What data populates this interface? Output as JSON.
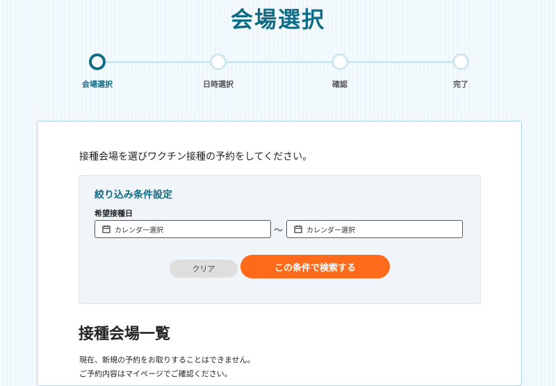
{
  "header": {
    "title": "会場選択"
  },
  "stepper": {
    "steps": [
      {
        "label": "会場選択",
        "active": true
      },
      {
        "label": "日時選択",
        "active": false
      },
      {
        "label": "確認",
        "active": false
      },
      {
        "label": "完了",
        "active": false
      }
    ]
  },
  "main": {
    "intro": "接種会場を選びワクチン接種の予約をしてください。",
    "filter": {
      "title": "絞り込み条件設定",
      "date_label": "希望接種日",
      "from_placeholder": "カレンダー選択",
      "range_separator": "〜",
      "to_placeholder": "カレンダー選択",
      "clear_label": "クリア",
      "search_label": "この条件で検索する"
    },
    "list": {
      "heading": "接種会場一覧",
      "notice": "現在、新規の予約をお取りすることはできません。",
      "notice_2": "ご予約内容はマイページでご確認ください。"
    }
  },
  "colors": {
    "brand": "#0f6b86",
    "accent": "#ff6b1a",
    "step_inactive": "#cfe6f1",
    "background": "#eef7fb"
  },
  "icons": {
    "date_field": "calendar-icon"
  }
}
